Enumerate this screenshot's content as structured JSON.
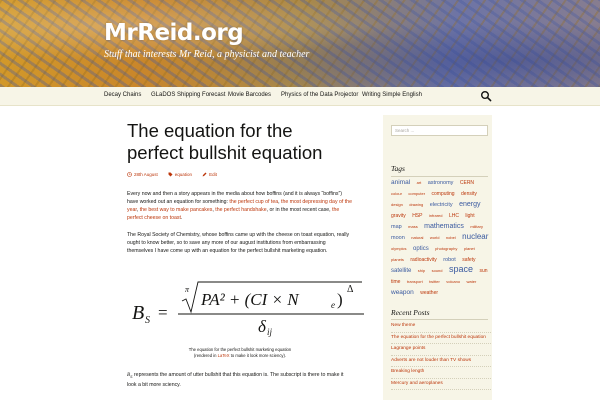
{
  "header": {
    "site_title": "MrReid.org",
    "tagline": "Stuff that interests Mr Reid, a physicist and teacher"
  },
  "nav": {
    "items": [
      {
        "label": "Decay Chains"
      },
      {
        "label": "GLaDOS Shipping Forecast"
      },
      {
        "label": "Movie Barcodes"
      },
      {
        "label": "Physics of the Data Projector"
      },
      {
        "label": "Writing Simple English"
      }
    ],
    "search_icon": "search-icon"
  },
  "article": {
    "title": "The equation for the perfect bullshit equation",
    "meta": {
      "date": "28th August",
      "tag": "equation",
      "edit": "Edit"
    },
    "para1_prefix": "Every now and then a story appears in the media about how boffins (and it is always “boffins”) have worked out an equation for something: ",
    "para1_links": [
      "the perfect cup of tea",
      "the most depressing day of the year",
      "the best way to make pancakes",
      "the perfect handshake",
      "the perfect cheese on toast"
    ],
    "para1_sep1": ", ",
    "para1_sep2": ", ",
    "para1_sep3": ", ",
    "para1_sep4": ", or in the most recent case, ",
    "para1_end": ".",
    "para2": "The Royal Society of Chemistry, whose boffins came up with the cheese on toast equation, really ought to know better, so to save any more of our august institutions from embarrassing themselves I have come up with an equation for the perfect bullshit marketing equation.",
    "equation": {
      "lhs_main": "B",
      "lhs_sub": "S",
      "root_index": "π",
      "numerator": "PA² + (CI × N",
      "numerator_sub": "e",
      "numerator_close": ")",
      "exponent": "Δ",
      "denominator": "δ",
      "denominator_sub": "ij"
    },
    "caption_line1": "The equation for the perfect bullshit marketing equation",
    "caption_line2_pre": "(rendered in ",
    "caption_line2_latex": "LaTeX",
    "caption_line2_post": " to make it look more sciency).",
    "para3_symbol": "B",
    "para3_symbol_sub": "S",
    "para3_text": " represents the amount of utter bullshit that this equation is. The subscript is there to make it look a bit more sciency."
  },
  "sidebar": {
    "search_placeholder": "Search ...",
    "tags_title": "Tags",
    "tags": [
      {
        "label": "animal",
        "size": 6.5
      },
      {
        "label": "art",
        "size": 4
      },
      {
        "label": "astronomy",
        "size": 5.5
      },
      {
        "label": "CERN",
        "size": 5
      },
      {
        "label": "colour",
        "size": 4
      },
      {
        "label": "computer",
        "size": 4
      },
      {
        "label": "computing",
        "size": 5
      },
      {
        "label": "density",
        "size": 5
      },
      {
        "label": "design",
        "size": 4
      },
      {
        "label": "drawing",
        "size": 4
      },
      {
        "label": "electricity",
        "size": 5.5
      },
      {
        "label": "energy",
        "size": 7
      },
      {
        "label": "gravity",
        "size": 5
      },
      {
        "label": "HSP",
        "size": 5
      },
      {
        "label": "infrared",
        "size": 4
      },
      {
        "label": "LHC",
        "size": 5
      },
      {
        "label": "light",
        "size": 5
      },
      {
        "label": "map",
        "size": 5.5
      },
      {
        "label": "mass",
        "size": 4
      },
      {
        "label": "mathematics",
        "size": 7
      },
      {
        "label": "military",
        "size": 4
      },
      {
        "label": "moon",
        "size": 5.5
      },
      {
        "label": "natural",
        "size": 4
      },
      {
        "label": "world",
        "size": 4
      },
      {
        "label": "nobel",
        "size": 4
      },
      {
        "label": "nuclear",
        "size": 8
      },
      {
        "label": "olympics",
        "size": 4
      },
      {
        "label": "optics",
        "size": 6
      },
      {
        "label": "photography",
        "size": 4
      },
      {
        "label": "planet",
        "size": 4
      },
      {
        "label": "planets",
        "size": 4
      },
      {
        "label": "radioactivity",
        "size": 5
      },
      {
        "label": "robot",
        "size": 5.5
      },
      {
        "label": "safety",
        "size": 5
      },
      {
        "label": "satellite",
        "size": 6
      },
      {
        "label": "ship",
        "size": 4
      },
      {
        "label": "sound",
        "size": 4
      },
      {
        "label": "space",
        "size": 9
      },
      {
        "label": "sun",
        "size": 5
      },
      {
        "label": "time",
        "size": 5
      },
      {
        "label": "transport",
        "size": 4
      },
      {
        "label": "twitter",
        "size": 4
      },
      {
        "label": "volcano",
        "size": 4
      },
      {
        "label": "water",
        "size": 4
      },
      {
        "label": "weapon",
        "size": 6.5
      },
      {
        "label": "weather",
        "size": 5
      }
    ],
    "recent_title": "Recent Posts",
    "recent_posts": [
      "New theme",
      "The equation for the perfect bullshit equation",
      "Lagrange points",
      "Adverts are not louder than TV shows",
      "Breaking length",
      "Mercury and aeroplanes"
    ]
  },
  "colors": {
    "link": "#bc360a",
    "sidebar_bg": "#f7f5e7"
  }
}
